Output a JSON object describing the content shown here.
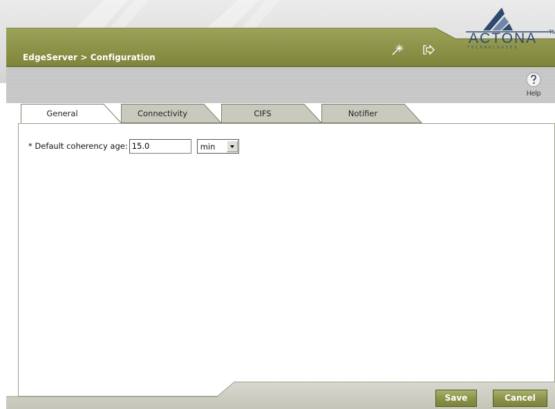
{
  "header": {
    "title": "EdgeServer > Configuration",
    "icons": [
      "wand-icon",
      "logout-icon"
    ]
  },
  "logo": {
    "name": "ACTONA",
    "trademark": "TM",
    "tagline": "TECHNOLOGIES"
  },
  "toolbar": {
    "help_label": "Help",
    "help_icon": "help-icon"
  },
  "tabs": [
    {
      "label": "General",
      "active": true
    },
    {
      "label": "Connectivity",
      "active": false
    },
    {
      "label": "CIFS",
      "active": false
    },
    {
      "label": "Notifier",
      "active": false
    }
  ],
  "form": {
    "coherency_label": "* Default coherency age:",
    "coherency_value": "15.0",
    "unit_selected": "min"
  },
  "actions": {
    "save_label": "Save",
    "cancel_label": "Cancel"
  },
  "colors": {
    "olive": "#8d934a",
    "olive_dark": "#6f7530",
    "logo_blue": "#2f4a6d"
  }
}
